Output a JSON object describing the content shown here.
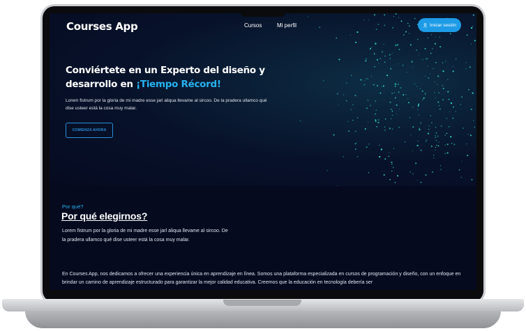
{
  "app": {
    "name": "Courses App"
  },
  "nav": {
    "items": [
      {
        "label": "Cursos"
      },
      {
        "label": "Mi perfil"
      }
    ],
    "login_label": "Iniciar sesión"
  },
  "hero": {
    "title": "Conviértete en un Experto del diseño y desarrollo en",
    "title_accent": "¡Tiempo Récord!",
    "text": "Lorem fistrum por la gloria de mi madre esse jarl aliqua llevame al sircoo. De la pradera ullamco qué dise usteer está la cosa muy malar.",
    "cta_label": "COMIENZA AHORA"
  },
  "why": {
    "eyebrow": "Por qué?",
    "title": "Por qué elegirnos?",
    "text": "Lorem fistrum por la gloria de mi madre esse jarl aliqua llevame al sircoo. De la pradera ullamco qué dise usteer está la cosa muy malar."
  },
  "about": {
    "text": "En Courses App, nos dedicamos a ofrecer una experiencia única en aprendizaje en línea. Somos una plataforma especializada en cursos de programación y diseño, con un enfoque en brindar un camino de aprendizaje estructurado para garantizar la mejor calidad educativa. Creemos que la educación en tecnología debería ser"
  },
  "colors": {
    "accent": "#27b2f0",
    "button": "#1e9be6",
    "background": "#070c24",
    "particles": "#35d6c8"
  }
}
